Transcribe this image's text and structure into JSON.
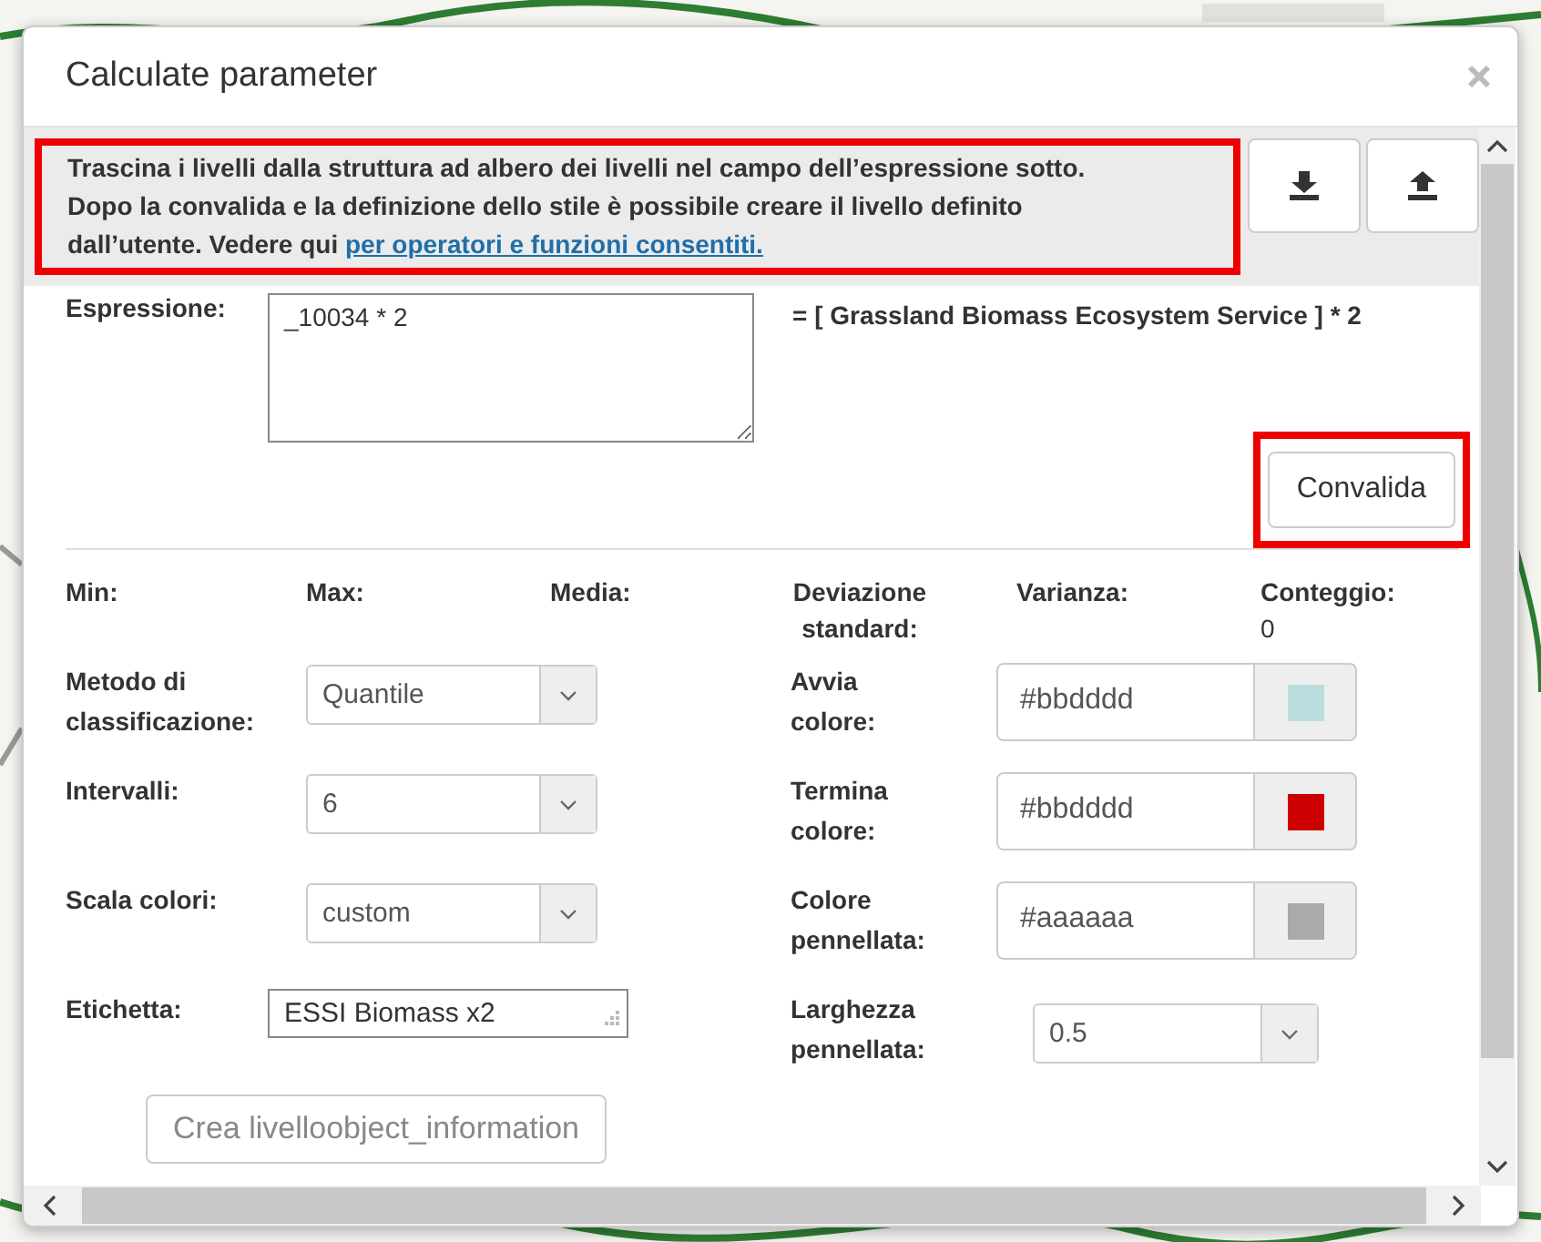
{
  "dialog": {
    "title": "Calculate parameter"
  },
  "notice": {
    "text": "Trascina i livelli dalla struttura ad albero dei livelli nel campo dell’espressione sotto. Dopo la convalida e la definizione dello stile è possibile creare il livello definito dall’utente. Vedere qui ",
    "link": "per operatori e funzioni consentiti.",
    "highlighted": true
  },
  "toolbar_buttons": [
    {
      "kind": "download"
    },
    {
      "kind": "upload"
    }
  ],
  "expression": {
    "label": "Espressione:",
    "value": "_10034 * 2",
    "result": "= [ Grassland Biomass Ecosystem Service ] * 2"
  },
  "validate_button": {
    "label": "Convalida",
    "highlighted": true
  },
  "stats": [
    {
      "label": "Min:"
    },
    {
      "label": "Max:"
    },
    {
      "label": "Media:"
    },
    {
      "label": "Deviazione standard:",
      "centered": true
    },
    {
      "label": "Varianza:"
    },
    {
      "label": "Conteggio:",
      "value": "0"
    }
  ],
  "left_fields": [
    {
      "kind": "select",
      "label": "Metodo di classificazione:",
      "value": "Quantile"
    },
    {
      "kind": "select",
      "label": "Intervalli:",
      "value": "6"
    },
    {
      "kind": "select",
      "label": "Scala colori:",
      "value": "custom"
    },
    {
      "kind": "text",
      "label": "Etichetta:",
      "value": "ESSI Biomass x2"
    }
  ],
  "right_fields": [
    {
      "kind": "color",
      "label": "Avvia colore:",
      "value": "#bbdddd",
      "color": "#bbdddd"
    },
    {
      "kind": "color",
      "label": "Termina colore:",
      "value": "#bbdddd",
      "color": "#cc0000"
    },
    {
      "kind": "color",
      "label": "Colore pennellata:",
      "value": "#aaaaaa",
      "color": "#aaaaaa"
    },
    {
      "kind": "select",
      "label": "Larghezza pennellata:",
      "value": "0.5"
    }
  ],
  "create_button": {
    "label": "Crea livelloobject_information"
  }
}
